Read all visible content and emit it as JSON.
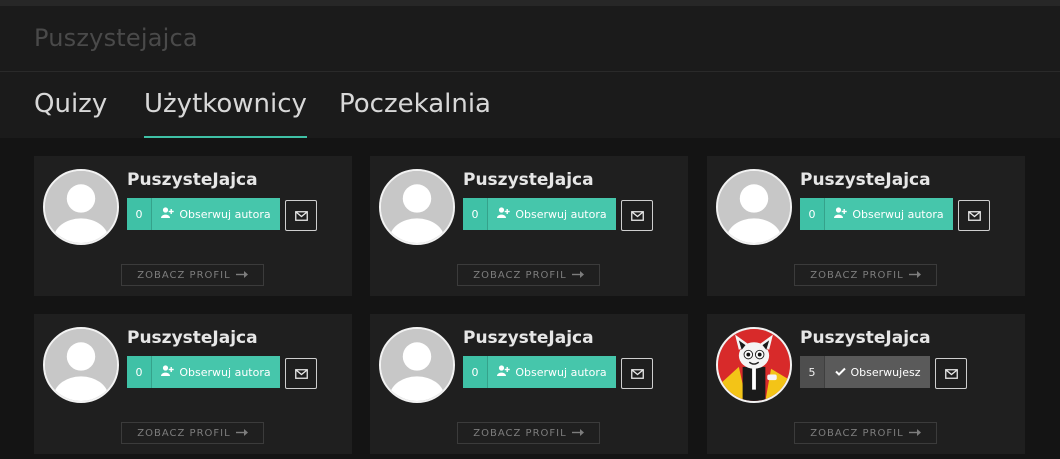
{
  "header": {
    "title": "Puszystejajca"
  },
  "tabs": [
    {
      "label": "Quizy",
      "active": false
    },
    {
      "label": "Użytkownicy",
      "active": true
    },
    {
      "label": "Poczekalnia",
      "active": false
    }
  ],
  "colors": {
    "accent": "#3fc1a6",
    "following": "#5a5a5a",
    "background": "#141414",
    "card": "#1f1f1f"
  },
  "cards": [
    {
      "name": "PuszysteJajca",
      "count": "0",
      "follow_label": "Obserwuj autora",
      "following": false,
      "avatar": "default-avatar",
      "profile_label": "ZOBACZ PROFIL"
    },
    {
      "name": "PuszysteJajca",
      "count": "0",
      "follow_label": "Obserwuj autora",
      "following": false,
      "avatar": "default-avatar",
      "profile_label": "ZOBACZ PROFIL"
    },
    {
      "name": "PuszysteJajca",
      "count": "0",
      "follow_label": "Obserwuj autora",
      "following": false,
      "avatar": "default-avatar",
      "profile_label": "ZOBACZ PROFIL"
    },
    {
      "name": "PuszysteJajca",
      "count": "0",
      "follow_label": "Obserwuj autora",
      "following": false,
      "avatar": "default-avatar",
      "profile_label": "ZOBACZ PROFIL"
    },
    {
      "name": "PuszysteJajca",
      "count": "0",
      "follow_label": "Obserwuj autora",
      "following": false,
      "avatar": "default-avatar",
      "profile_label": "ZOBACZ PROFIL"
    },
    {
      "name": "PuszysteJajca",
      "count": "5",
      "follow_label": "Obserwujesz",
      "following": true,
      "avatar": "cartoon-avatar",
      "profile_label": "ZOBACZ PROFIL"
    }
  ]
}
